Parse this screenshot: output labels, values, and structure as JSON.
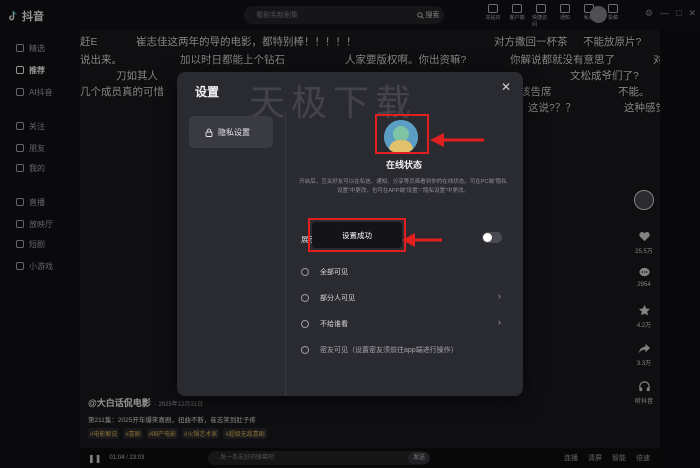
{
  "app": {
    "name": "抖音"
  },
  "search": {
    "placeholder": "看剧毛新剧集",
    "button": "搜索"
  },
  "top_actions": [
    "充钻石",
    "客户端",
    "快捷访问",
    "通知",
    "私信",
    "投稿"
  ],
  "sidebar": {
    "items": [
      {
        "label": "精选",
        "icon": "grid-icon"
      },
      {
        "label": "推荐",
        "icon": "plus-icon",
        "active": true
      },
      {
        "label": "AI抖音",
        "icon": "ai-icon"
      },
      {
        "label": "关注",
        "icon": "follow-icon"
      },
      {
        "label": "朋友",
        "icon": "friends-icon"
      },
      {
        "label": "我的",
        "icon": "profile-icon"
      },
      {
        "label": "直播",
        "icon": "live-icon"
      },
      {
        "label": "放映厅",
        "icon": "cinema-icon"
      },
      {
        "label": "短剧",
        "icon": "drama-icon"
      },
      {
        "label": "小游戏",
        "icon": "game-icon"
      }
    ]
  },
  "danmu": [
    "赶E",
    "崔志佳这两年的导的电影，都特别棒！！！！！",
    "对方撒回一杯茶",
    "不能放原片?",
    "说出来。",
    "加以时日都能上个钻石",
    "人家要版权啊。你出资嘛?",
    "你解说都就没有意思了",
    "对",
    "刀如其人",
    "文松成爷们了?",
    "几个成员真的可惜",
    "该告席",
    "不能。",
    "这种感觉",
    "这说?？？"
  ],
  "video": {
    "author": "@大白话侃电影",
    "date": "· 2025年12月31日",
    "description": "第211集：2025开年爆笑喜剧，扭曲不断，崔志笑到肚子疼",
    "tags": [
      "#电影解说",
      "#喜剧",
      "#国产电影",
      "#火锅艺术家",
      "#超级无敌喜剧"
    ],
    "time": "01:04 / 23:03",
    "danmu_placeholder": "发一条友好的弹幕吧",
    "send": "发送",
    "controls_right": [
      "连播",
      "清屏",
      "智能",
      "倍速"
    ]
  },
  "actions": [
    {
      "icon": "heart-icon",
      "count": "25.5万"
    },
    {
      "icon": "comment-icon",
      "count": "2954"
    },
    {
      "icon": "star-icon",
      "count": "4.2万"
    },
    {
      "icon": "share-icon",
      "count": "3.3万"
    },
    {
      "icon": "headphone-icon",
      "count": "听抖音"
    }
  ],
  "modal": {
    "title": "设置",
    "watermark": "天极下载",
    "side_item": "隐私设置",
    "status_title": "在线状态",
    "status_desc": "开启后，互关好友可以在私信、通知、分享等页面看到你的在线状态。可在PC端“隐私设置”中更改，也可在APP端“设置”-“隐私设置”中更改。",
    "show_label": "展示",
    "toast": "设置成功",
    "options": [
      {
        "label": "全部可见",
        "chevron": false
      },
      {
        "label": "部分人可见",
        "chevron": true
      },
      {
        "label": "不给谁看",
        "chevron": true
      },
      {
        "label": "密友可见（设置密友须前往app端进行操作）",
        "chevron": false,
        "dim": true
      }
    ],
    "toggle_on": false
  },
  "colors": {
    "highlight": "#e02020",
    "accent_tag": "#e8c15a"
  }
}
